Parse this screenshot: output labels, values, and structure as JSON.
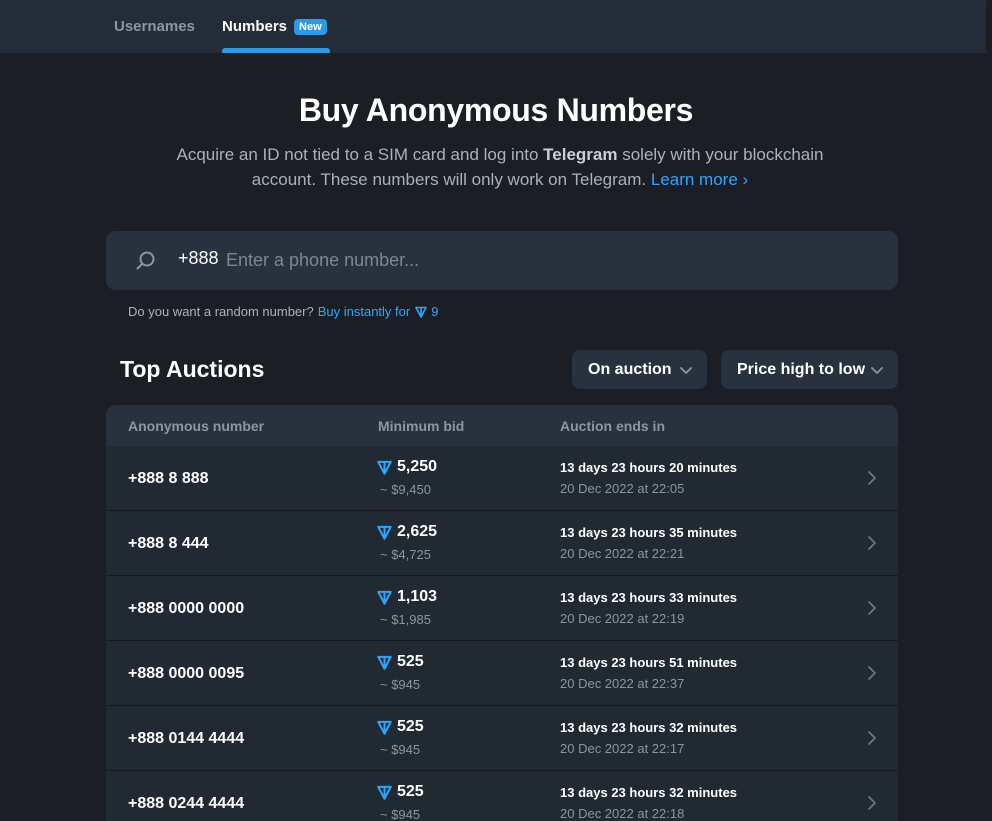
{
  "nav": {
    "tabs": [
      {
        "label": "Usernames"
      },
      {
        "label": "Numbers",
        "badge": "New"
      }
    ]
  },
  "hero": {
    "title": "Buy Anonymous Numbers",
    "desc_part1": "Acquire an ID not tied to a SIM card and log into ",
    "desc_bold": "Telegram",
    "desc_part2": " solely with your blockchain account. These numbers will only work on Telegram. ",
    "learn_more": "Learn more ›"
  },
  "search": {
    "prefix": "+888",
    "placeholder": "Enter a phone number..."
  },
  "random": {
    "question": "Do you want a random number?",
    "link": "Buy instantly for",
    "price": "9"
  },
  "auctions": {
    "title": "Top Auctions",
    "filter_label": "On auction",
    "sort_label": "Price high to low",
    "columns": [
      "Anonymous number",
      "Minimum bid",
      "Auction ends in"
    ],
    "rows": [
      {
        "number": "+888 8 888",
        "bid": "5,250",
        "usd": "~ $9,450",
        "ends": "13 days 23 hours 20 minutes",
        "date": "20 Dec 2022 at 22:05"
      },
      {
        "number": "+888 8 444",
        "bid": "2,625",
        "usd": "~ $4,725",
        "ends": "13 days 23 hours 35 minutes",
        "date": "20 Dec 2022 at 22:21"
      },
      {
        "number": "+888 0000 0000",
        "bid": "1,103",
        "usd": "~ $1,985",
        "ends": "13 days 23 hours 33 minutes",
        "date": "20 Dec 2022 at 22:19"
      },
      {
        "number": "+888 0000 0095",
        "bid": "525",
        "usd": "~ $945",
        "ends": "13 days 23 hours 51 minutes",
        "date": "20 Dec 2022 at 22:37"
      },
      {
        "number": "+888 0144 4444",
        "bid": "525",
        "usd": "~ $945",
        "ends": "13 days 23 hours 32 minutes",
        "date": "20 Dec 2022 at 22:17"
      },
      {
        "number": "+888 0244 4444",
        "bid": "525",
        "usd": "~ $945",
        "ends": "13 days 23 hours 32 minutes",
        "date": "20 Dec 2022 at 22:18"
      }
    ]
  },
  "colors": {
    "background": "#1b1f25",
    "panel": "#27323e",
    "accent": "#2ea6ff",
    "ton": "#2ea6ff"
  }
}
